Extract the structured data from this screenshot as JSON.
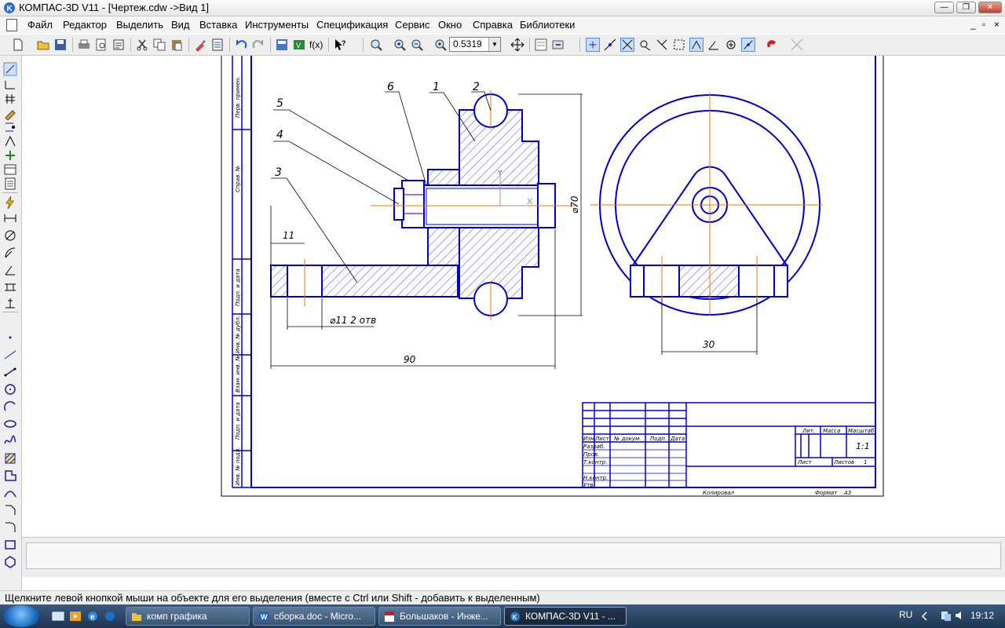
{
  "window": {
    "title": "КОМПАС-3D V11 - [Чертеж.cdw ->Вид 1]",
    "minimize": "—",
    "maximize": "❐",
    "close": "✕"
  },
  "menu": {
    "items": [
      "Файл",
      "Редактор",
      "Выделить",
      "Вид",
      "Вставка",
      "Инструменты",
      "Спецификация",
      "Сервис",
      "Окно",
      "Справка",
      "Библиотеки"
    ],
    "mdi_min": "_",
    "mdi_restore": "▫",
    "mdi_close": "×"
  },
  "toolbar": {
    "zoom_value": "0.5319",
    "fx_label": "f(x)"
  },
  "drawing": {
    "leaders": [
      "1",
      "2",
      "3",
      "4",
      "5",
      "6"
    ],
    "dim_11": "11",
    "dim_holes": "⌀11 2 отв",
    "dim_90": "90",
    "dim_d70": "⌀70",
    "dim_30": "30",
    "axis_x": "X",
    "axis_y": "Y",
    "side_frame": {
      "perv_primen": "Перв. примен.",
      "sprav_no": "Справ. №",
      "podp_data_1": "Подп. и дата",
      "inv_dubl": "Инв. № дубл.",
      "vzam_inv": "Взам. инв. №",
      "podp_data_2": "Подп. и дата",
      "inv_podl": "Инв. № подл."
    },
    "title_block": {
      "izm": "Изм",
      "list": "Лист",
      "n_dokum": "№ докум.",
      "podp": "Подп.",
      "data": "Дата",
      "razrab": "Разраб.",
      "prov": "Пров.",
      "tkontr": "Т.контр.",
      "nkontr": "Н.контр.",
      "utv": "Утв.",
      "lit": "Лит.",
      "massa": "Масса",
      "masshtab": "Масштаб",
      "scale_value": "1:1",
      "list_right": "Лист",
      "listov": "Листов",
      "listov_value": "1",
      "kopiroval": "Копировал",
      "format": "Формат",
      "format_value": "А3"
    }
  },
  "status_text": "Щелкните левой кнопкой мыши на объекте для его выделения (вместе с Ctrl или Shift - добавить к выделенным)",
  "taskbar": {
    "tasks": [
      "комп графика",
      "сборка.doc - Micro...",
      "Большаков - Инже...",
      "КОМПАС-3D V11 - ..."
    ],
    "language": "RU",
    "time": "19:12"
  },
  "colors": {
    "drawing_lines": "#0000cc",
    "axis_lines": "#e07b00",
    "title_bar": "#f0f0f0",
    "taskbar": "#2a4466"
  }
}
